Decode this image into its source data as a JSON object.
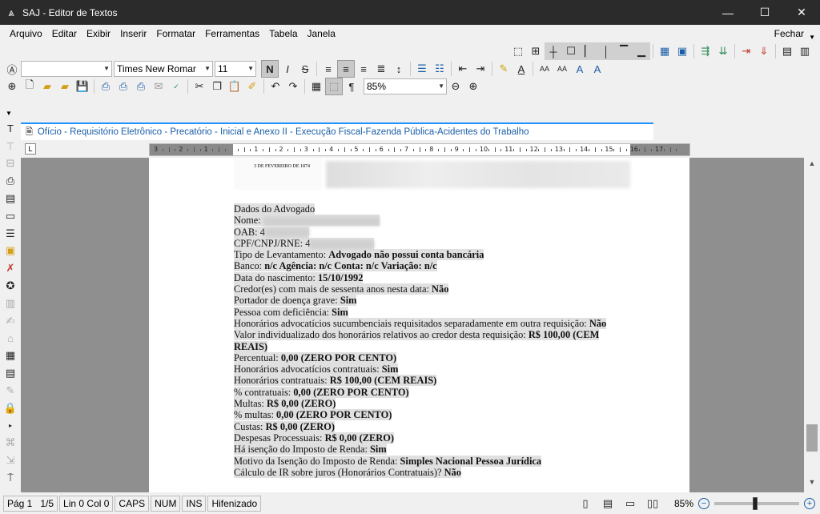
{
  "window": {
    "title": "SAJ - Editor de Textos",
    "minimize": "—",
    "maximize": "☐",
    "close": "✕"
  },
  "menubar": {
    "items": [
      "Arquivo",
      "Editar",
      "Exibir",
      "Inserir",
      "Formatar",
      "Ferramentas",
      "Tabela",
      "Janela"
    ],
    "fechar": "Fechar"
  },
  "format_toolbar": {
    "style_value": "",
    "font_value": "Times New Romar",
    "size_value": "11",
    "zoom_value": "85%"
  },
  "tab": {
    "title": "Ofício - Requisitório Eletrônico - Precatório - Inicial e Anexo II - Execução Fiscal-Fazenda Pública-Acidentes do Trabalho"
  },
  "ruler": {
    "labels": [
      "3",
      "2",
      "1",
      "",
      "1",
      "2",
      "3",
      "4",
      "5",
      "6",
      "7",
      "8",
      "9",
      "10",
      "11",
      "12",
      "13",
      "14",
      "15",
      "16",
      "17"
    ]
  },
  "document": {
    "letterhead_date": "3 DE FEVEREIRO DE 1874",
    "lines": [
      {
        "label": "Dados do Advogado",
        "value": ""
      },
      {
        "label": "Nome: ",
        "value": ""
      },
      {
        "label": "OAB: ",
        "value": "4"
      },
      {
        "label": "CPF/CNPJ/RNE: ",
        "value": "4"
      },
      {
        "label": "Tipo de Levantamento: ",
        "value": "Advogado não possui conta bancária"
      },
      {
        "label": "Banco: ",
        "value": "n/c  Agência: n/c  Conta: n/c  Variação: n/c"
      },
      {
        "label": "Data do nascimento: ",
        "value": "15/10/1992"
      },
      {
        "label": "Credor(es) com mais de sessenta anos nesta data: ",
        "value": "Não"
      },
      {
        "label": "Portador de doença grave: ",
        "value": "Sim"
      },
      {
        "label": "Pessoa com deficiência: ",
        "value": "Sim"
      },
      {
        "label": "Honorários advocatícios sucumbenciais requisitados separadamente em outra requisição: ",
        "value": "Não"
      },
      {
        "label": "Valor individualizado dos honorários relativos ao credor desta requisição: ",
        "value": "R$ 100,00 (CEM REAIS)"
      },
      {
        "label": "Percentual: ",
        "value": "0,00 (ZERO POR CENTO)"
      },
      {
        "label": "Honorários advocatícios contratuais: ",
        "value": "Sim"
      },
      {
        "label": "Honorários contratuais: ",
        "value": "R$ 100,00 (CEM REAIS)"
      },
      {
        "label": "% contratuais: ",
        "value": "0,00 (ZERO POR CENTO)"
      },
      {
        "label": "Multas: ",
        "value": "R$ 0,00 (ZERO)"
      },
      {
        "label": "% multas: ",
        "value": "0,00 (ZERO POR CENTO)"
      },
      {
        "label": "Custas: ",
        "value": "R$ 0,00 (ZERO)"
      },
      {
        "label": "Despesas Processuais: ",
        "value": "R$ 0,00 (ZERO)"
      },
      {
        "label": "Há isenção do Imposto de Renda: ",
        "value": "Sim"
      },
      {
        "label": "Motivo da Isenção do Imposto de Renda: ",
        "value": "Simples Nacional Pessoa Jurídica"
      },
      {
        "label": "Cálculo de IR sobre juros (Honorários Contratuais)? ",
        "value": "Não"
      }
    ]
  },
  "statusbar": {
    "page": "Pág 1",
    "pages": "1/5",
    "position": "Lin 0  Col 0",
    "caps": "CAPS",
    "num": "NUM",
    "ins": "INS",
    "hyphen": "Hifenizado",
    "zoom": "85%"
  }
}
